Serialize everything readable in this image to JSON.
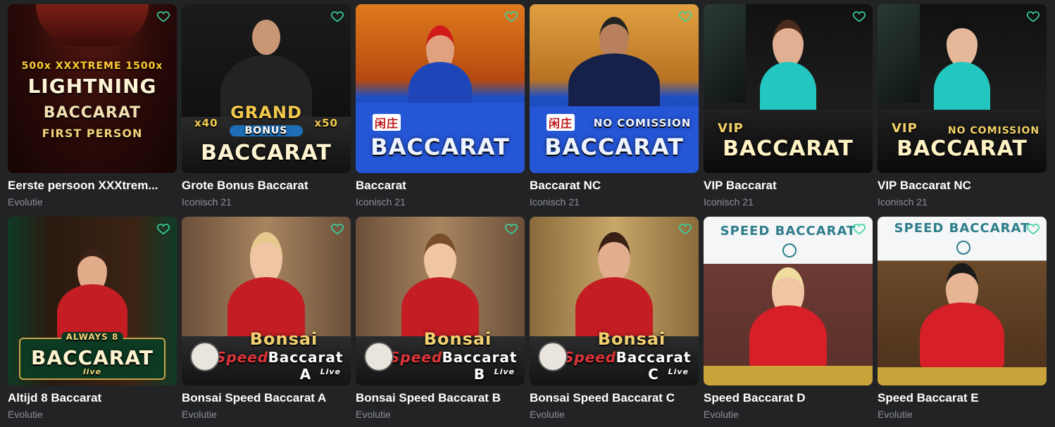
{
  "colors": {
    "background": "#222325",
    "title": "#ffffff",
    "provider": "#8e9196",
    "heart": "#38d39f"
  },
  "icons": {
    "favorite": "heart-outline-icon"
  },
  "games": [
    {
      "title": "Eerste persoon XXXtrem...",
      "provider": "Evolutie",
      "art": {
        "line1": "500x XXXTREME 1500x",
        "line2": "LIGHTNING",
        "line3": "BACCARAT",
        "line4": "FIRST PERSON"
      }
    },
    {
      "title": "Grote Bonus Baccarat",
      "provider": "Iconisch 21",
      "art": {
        "line1": "GRAND",
        "line2": "BONUS",
        "line3": "BACCARAT",
        "mult_left": "x40",
        "mult_right": "x50"
      }
    },
    {
      "title": "Baccarat",
      "provider": "Iconisch 21",
      "art": {
        "badge": "闲庄",
        "line1": "BACCARAT"
      }
    },
    {
      "title": "Baccarat NC",
      "provider": "Iconisch 21",
      "art": {
        "badge": "闲庄",
        "line1": "NO COMISSION",
        "line2": "BACCARAT"
      }
    },
    {
      "title": "VIP Baccarat",
      "provider": "Iconisch 21",
      "art": {
        "line1": "VIP",
        "line2": "BACCARAT"
      }
    },
    {
      "title": "VIP Baccarat NC",
      "provider": "Iconisch 21",
      "art": {
        "line1": "VIP",
        "line2": "NO COMISSION",
        "line3": "BACCARAT"
      }
    },
    {
      "title": "Altijd 8 Baccarat",
      "provider": "Evolutie",
      "art": {
        "line1": "ALWAYS 8",
        "line2": "BACCARAT",
        "line3": "live"
      }
    },
    {
      "title": "Bonsai Speed Baccarat A",
      "provider": "Evolutie",
      "art": {
        "line1": "Bonsai",
        "line2": "Speed",
        "line3": "Baccarat A",
        "line4": "Live"
      }
    },
    {
      "title": "Bonsai Speed Baccarat B",
      "provider": "Evolutie",
      "art": {
        "line1": "Bonsai",
        "line2": "Speed",
        "line3": "Baccarat B",
        "line4": "Live"
      }
    },
    {
      "title": "Bonsai Speed Baccarat C",
      "provider": "Evolutie",
      "art": {
        "line1": "Bonsai",
        "line2": "Speed",
        "line3": "Baccarat C",
        "line4": "Live"
      }
    },
    {
      "title": "Speed Baccarat D",
      "provider": "Evolutie",
      "art": {
        "line1": "SPEED BACCARAT"
      }
    },
    {
      "title": "Speed Baccarat E",
      "provider": "Evolutie",
      "art": {
        "line1": "SPEED BACCARAT"
      }
    }
  ]
}
